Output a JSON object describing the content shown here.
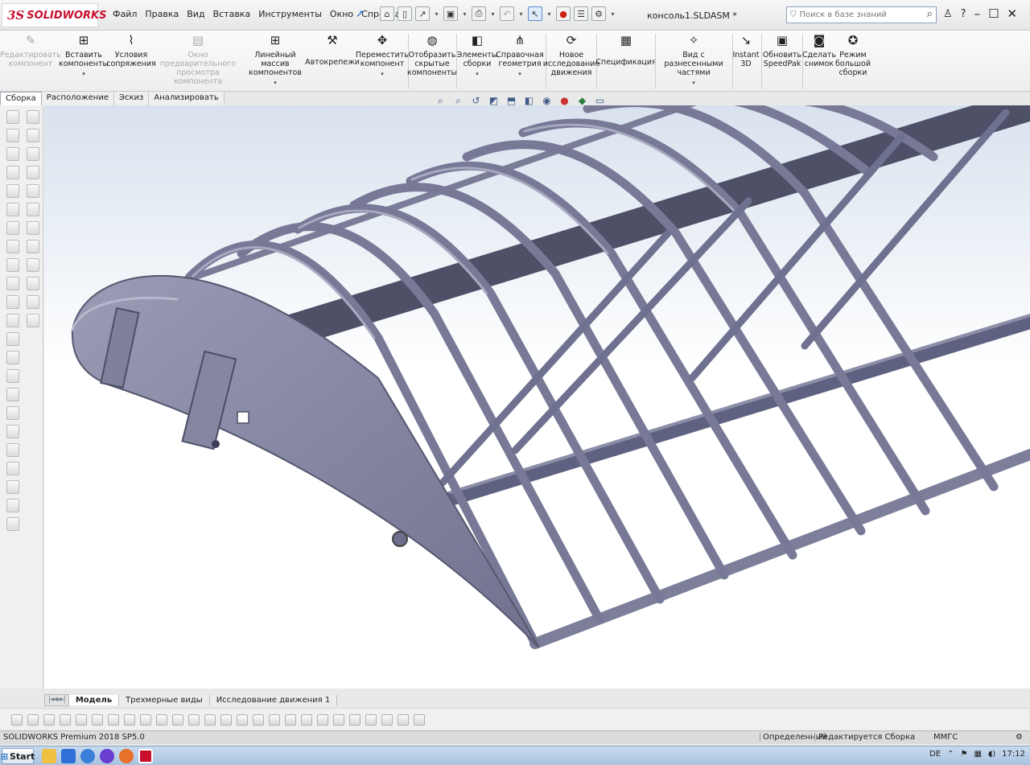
{
  "app": {
    "logo_ds": "3S",
    "logo_text": "SOLIDWORKS",
    "filename": "консоль1.SLDASM *"
  },
  "menu": [
    "Файл",
    "Правка",
    "Вид",
    "Вставка",
    "Инструменты",
    "Окно",
    "Справка"
  ],
  "search": {
    "placeholder": "Поиск в базе знаний"
  },
  "ribbon": [
    {
      "label1": "Редактировать",
      "label2": "компонент",
      "disabled": true
    },
    {
      "label1": "Вставить",
      "label2": "компоненты",
      "caret": true
    },
    {
      "label1": "Условия",
      "label2": "сопряжения"
    },
    {
      "label1": "Окно предварительного",
      "label2": "просмотра компонента",
      "disabled": true
    },
    {
      "label1": "Линейный массив",
      "label2": "компонентов",
      "caret": true
    },
    {
      "label1": "Автокрепежи",
      "label2": ""
    },
    {
      "label1": "Переместить",
      "label2": "компонент",
      "caret": true
    },
    {
      "label1": "Отобразить",
      "label2": "скрытые",
      "label3": "компоненты"
    },
    {
      "label1": "Элементы",
      "label2": "сборки",
      "caret": true
    },
    {
      "label1": "Справочная",
      "label2": "геометрия",
      "caret": true
    },
    {
      "label1": "Новое",
      "label2": "исследование",
      "label3": "движения"
    },
    {
      "label1": "Спецификация",
      "label2": ""
    },
    {
      "label1": "Вид с разнесенными",
      "label2": "частями",
      "caret": true
    },
    {
      "label1": "Instant",
      "label2": "3D"
    },
    {
      "label1": "Обновить",
      "label2": "SpeedPak"
    },
    {
      "label1": "Сделать",
      "label2": "снимок"
    },
    {
      "label1": "Режим",
      "label2": "большой",
      "label3": "сборки"
    }
  ],
  "cmtabs": [
    "Сборка",
    "Расположение",
    "Эскиз",
    "Анализировать"
  ],
  "bottom_tabs": [
    "Модель",
    "Трехмерные виды",
    "Исследование движения 1"
  ],
  "status": {
    "product": "SOLIDWORKS Premium 2018 SP5.0",
    "defined": "Определенный",
    "editing": "Редактируется Сборка",
    "units": "ММГС"
  },
  "taskbar": {
    "start": "Start",
    "lang": "DE",
    "time": "17:12"
  }
}
